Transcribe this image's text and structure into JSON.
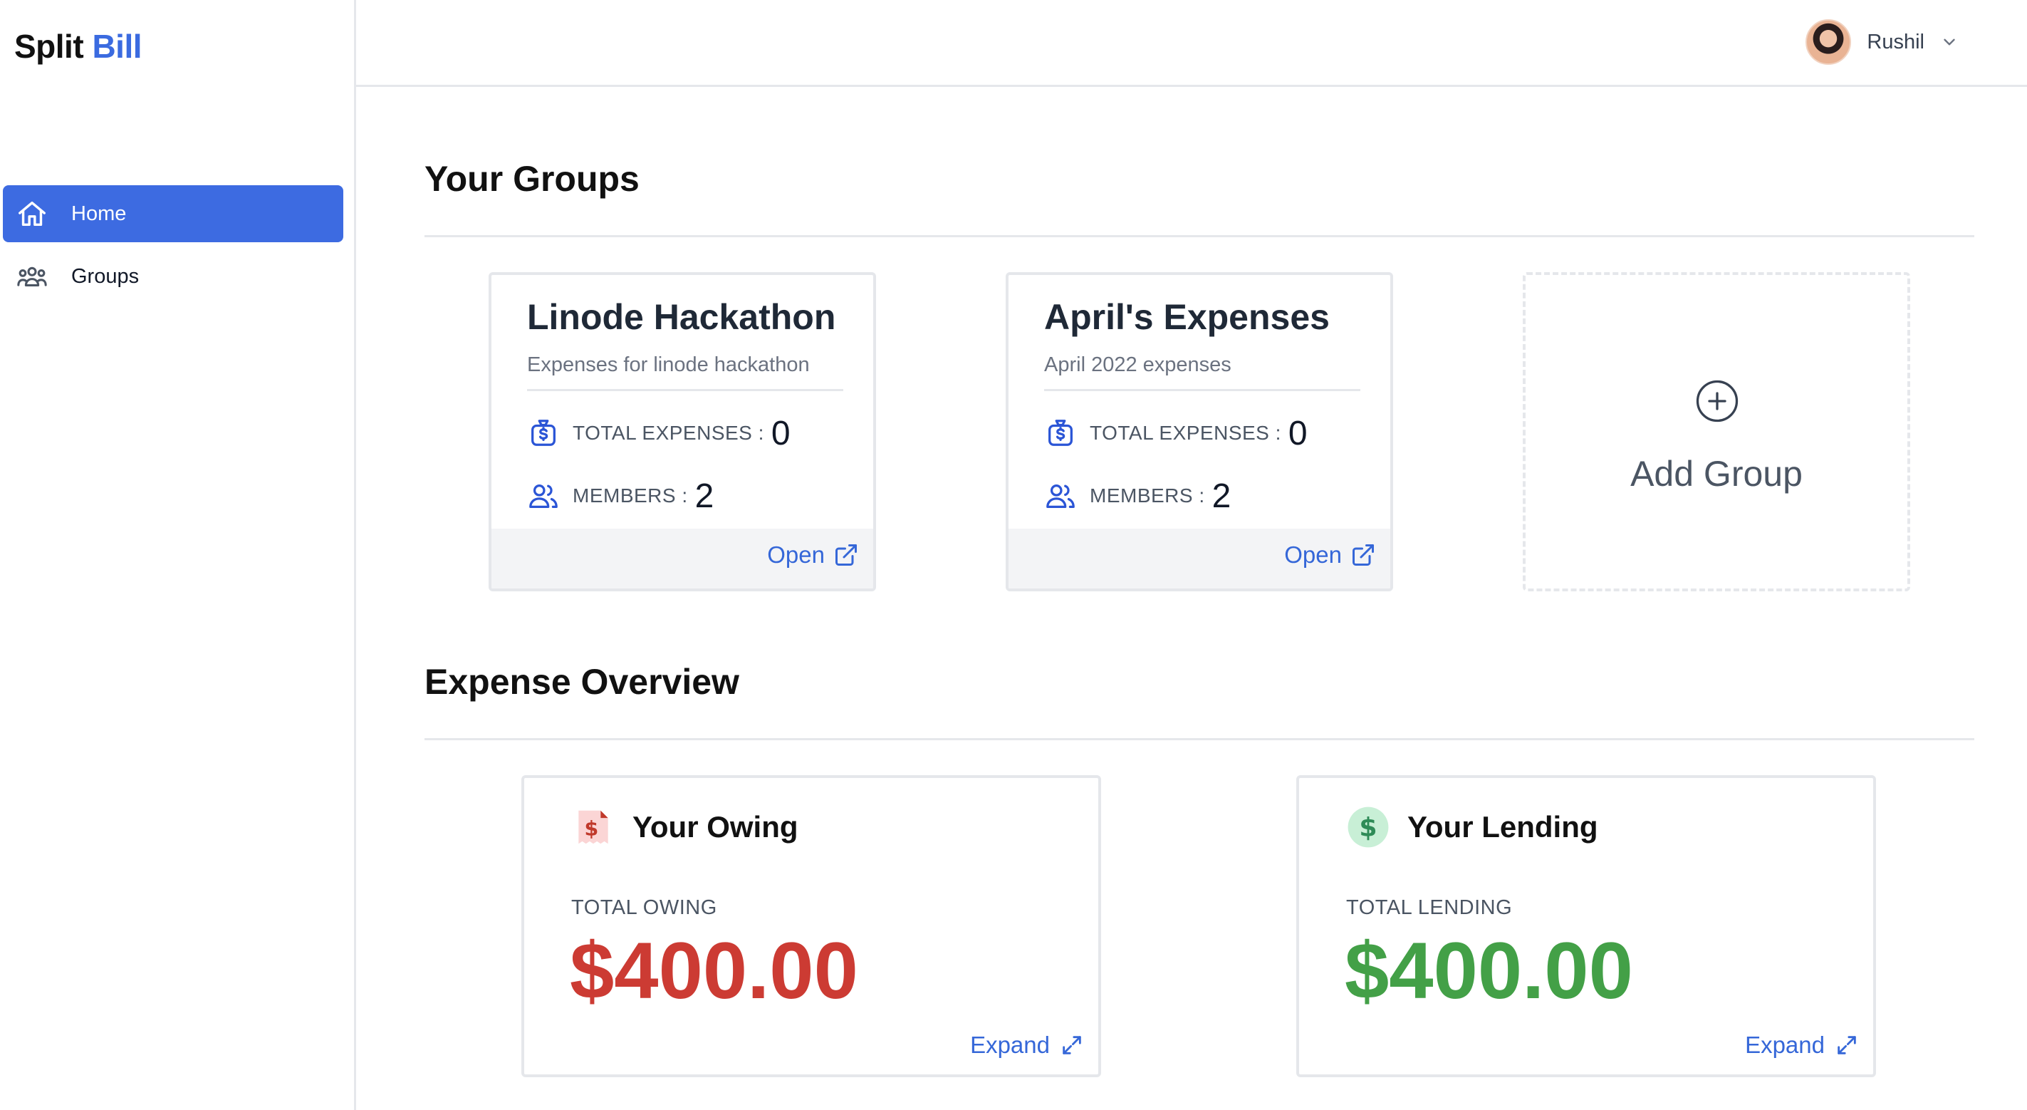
{
  "app": {
    "brand_part1": "Split",
    "brand_part2": "Bill"
  },
  "sidebar": {
    "items": [
      {
        "label": "Home",
        "icon": "home-icon",
        "active": true
      },
      {
        "label": "Groups",
        "icon": "users-icon",
        "active": false
      }
    ]
  },
  "header": {
    "user_name": "Rushil"
  },
  "groups_section": {
    "title": "Your Groups",
    "cards": [
      {
        "title": "Linode Hackathon",
        "description": "Expenses for linode hackathon",
        "total_expenses_label": "TOTAL EXPENSES :",
        "total_expenses": "0",
        "members_label": "MEMBERS :",
        "members": "2",
        "open_label": "Open"
      },
      {
        "title": "April's Expenses",
        "description": "April 2022 expenses",
        "total_expenses_label": "TOTAL EXPENSES :",
        "total_expenses": "0",
        "members_label": "MEMBERS :",
        "members": "2",
        "open_label": "Open"
      }
    ],
    "add_label": "Add Group"
  },
  "overview_section": {
    "title": "Expense Overview",
    "owing": {
      "title": "Your Owing",
      "label": "TOTAL OWING",
      "amount": "$400.00",
      "expand_label": "Expand",
      "color": "#cc3b33"
    },
    "lending": {
      "title": "Your Lending",
      "label": "TOTAL LENDING",
      "amount": "$400.00",
      "expand_label": "Expand",
      "color": "#43a047"
    }
  },
  "colors": {
    "accent": "#3d6be1",
    "link": "#3567d8"
  }
}
